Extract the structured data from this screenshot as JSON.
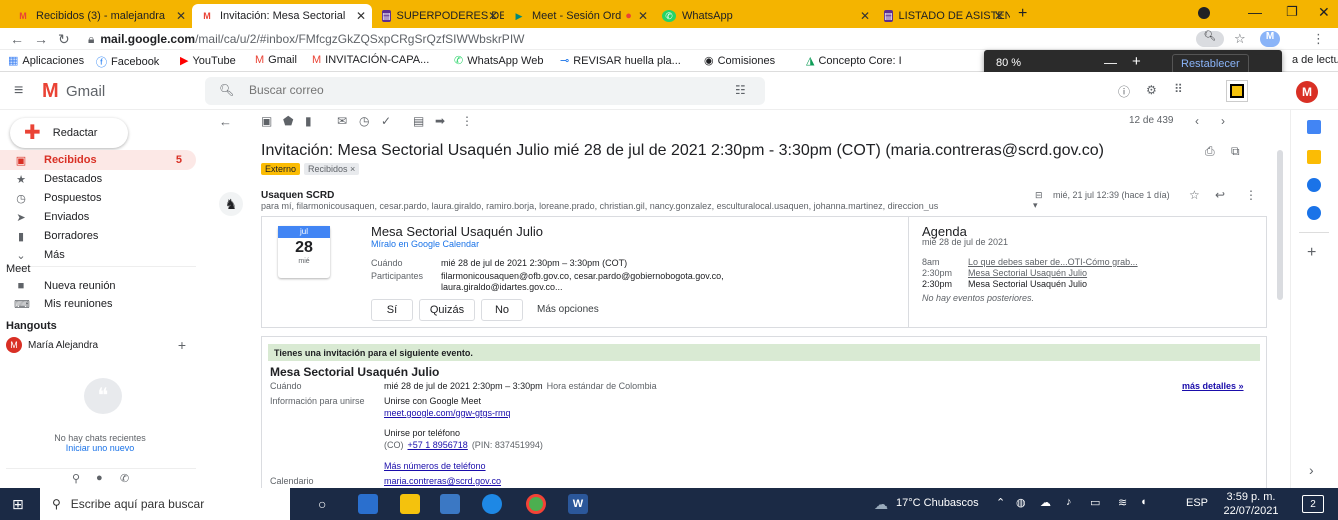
{
  "tabs": [
    {
      "label": "Recibidos (3) - malejandra",
      "fav": "M",
      "favcolor": "#ea4335"
    },
    {
      "label": "Invitación: Mesa Sectorial",
      "fav": "M",
      "favcolor": "#ea4335"
    },
    {
      "label": "SUPERPODERES DE LA",
      "fav": "▤",
      "favcolor": "#5c2d91"
    },
    {
      "label": "Meet - Sesión Ord",
      "fav": "▶",
      "favcolor": "#00897b"
    },
    {
      "label": "WhatsApp",
      "fav": "✆",
      "favcolor": "#25d366"
    },
    {
      "label": "LISTADO DE ASISTENC",
      "fav": "▤",
      "favcolor": "#5c2d91"
    }
  ],
  "new_tab": "+",
  "address": {
    "host": "mail.google.com",
    "path": "/mail/ca/u/2/#inbox/FMfcgzGkZQSxpCRgSrQzfSIWWbskrPIW"
  },
  "bookmarks": [
    "Aplicaciones",
    "Facebook",
    "YouTube",
    "Gmail",
    "INVITACIÓN-CAPA...",
    "WhatsApp Web",
    "REVISAR huella pla...",
    "Comisiones",
    "Concepto Core: I"
  ],
  "reading_list": "a de lectura",
  "zoom": {
    "level": "80 %",
    "minus": "—",
    "plus": "+",
    "reset": "Restablecer"
  },
  "gmail": {
    "logo": "Gmail",
    "search_placeholder": "Buscar correo",
    "profile_initial": "M"
  },
  "compose": "Redactar",
  "nav": [
    {
      "label": "Recibidos",
      "count": "5",
      "icon": "inbox-icon",
      "glyph": "▣"
    },
    {
      "label": "Destacados",
      "count": "",
      "icon": "star-icon",
      "glyph": "★"
    },
    {
      "label": "Pospuestos",
      "count": "",
      "icon": "clock-icon",
      "glyph": "◷"
    },
    {
      "label": "Enviados",
      "count": "",
      "icon": "send-icon",
      "glyph": "➤"
    },
    {
      "label": "Borradores",
      "count": "",
      "icon": "draft-icon",
      "glyph": "▮"
    },
    {
      "label": "Más",
      "count": "",
      "icon": "chevron-down-icon",
      "glyph": "⌄"
    }
  ],
  "meet": {
    "title": "Meet",
    "new": "Nueva reunión",
    "mine": "Mis reuniones"
  },
  "hangouts": {
    "title": "Hangouts",
    "user": "María Alejandra",
    "no_chats": "No hay chats recientes",
    "start": "Iniciar uno nuevo"
  },
  "pager": "12 de 439",
  "subject": "Invitación: Mesa Sectorial Usaquén Julio mié 28 de jul de 2021 2:30pm - 3:30pm (COT) (maria.contreras@scrd.gov.co)",
  "labels": [
    "Externo",
    "Recibidos ×"
  ],
  "sender": "Usaquen SCRD",
  "recipients": "para mí, filarmonicousaquen, cesar.pardo, laura.giraldo, ramiro.borja, loreane.prado, christian.gil, nancy.gonzalez, esculturalocal.usaquen, johanna.martinez, direccion_us",
  "date": "mié, 21 jul 12:39 (hace 1 día)",
  "calcard": {
    "month": "jul",
    "day": "28",
    "weekday": "mié",
    "title": "Mesa Sectorial Usaquén Julio",
    "gcal": "Míralo en Google Calendar",
    "when_label": "Cuándo",
    "when": "mié 28 de jul de 2021 2:30pm – 3:30pm (COT)",
    "part_label": "Participantes",
    "part1": "filarmonicousaquen@ofb.gov.co, cesar.pardo@gobiernobogota.gov.co,",
    "part2": "laura.giraldo@idartes.gov.co...",
    "yes": "Sí",
    "maybe": "Quizás",
    "no": "No",
    "more": "Más opciones"
  },
  "agenda": {
    "title": "Agenda",
    "date": "mié 28 de jul de 2021",
    "items": [
      {
        "time": "8am",
        "text": "Lo que debes saber de...OTI-Cómo grab..."
      },
      {
        "time": "2:30pm",
        "text": "Mesa Sectorial Usaquén Julio"
      },
      {
        "time": "2:30pm",
        "text": "Mesa Sectorial Usaquén Julio"
      }
    ],
    "none": "No hay eventos posteriores."
  },
  "invite": {
    "banner": "Tienes una invitación para el siguiente evento.",
    "title": "Mesa Sectorial Usaquén Julio",
    "when_label": "Cuándo",
    "when": "mié 28 de jul de 2021 2:30pm – 3:30pm",
    "tz": "Hora estándar de Colombia",
    "details": "más detalles »",
    "join_label": "Información para unirse",
    "join_meet": "Unirse con Google Meet",
    "meet_link": "meet.google.com/ggw-gtgs-rmq",
    "phone_title": "Unirse por teléfono",
    "phone_prefix": "(CO)",
    "phone": "+57 1 8956718",
    "pin": "(PIN: 837451994)",
    "more_phones": "Más números de teléfono",
    "cal_label": "Calendario",
    "cal": "maria.contreras@scrd.gov.co"
  },
  "taskbar": {
    "search": "Escribe aquí para buscar",
    "weather": "17°C Chubascos",
    "lang": "ESP",
    "time": "3:59 p. m.",
    "date": "22/07/2021",
    "notif": "2"
  }
}
